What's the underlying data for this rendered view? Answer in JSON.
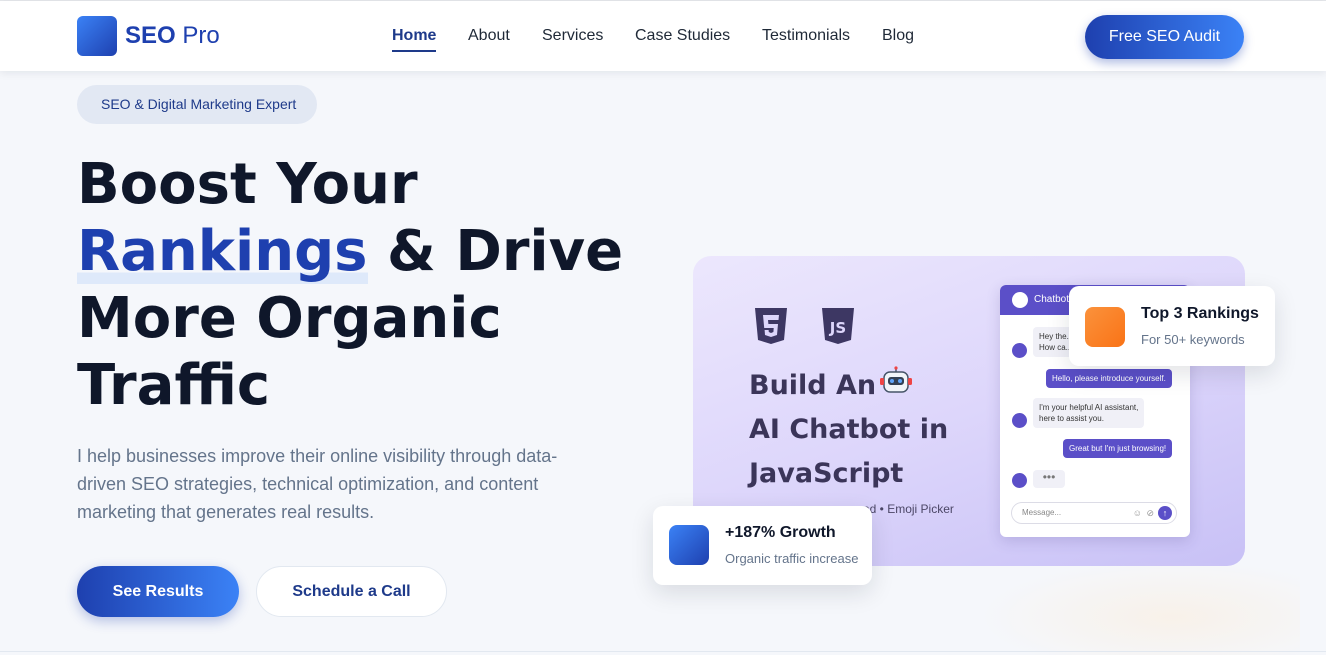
{
  "brand": {
    "name_bold": "SEO",
    "name_light": "Pro"
  },
  "nav": {
    "items": [
      {
        "label": "Home",
        "active": true
      },
      {
        "label": "About"
      },
      {
        "label": "Services"
      },
      {
        "label": "Case Studies"
      },
      {
        "label": "Testimonials"
      },
      {
        "label": "Blog"
      }
    ],
    "cta_label": "Free SEO Audit"
  },
  "hero": {
    "badge": "SEO & Digital Marketing Expert",
    "headline": {
      "line1": "Boost Your",
      "accent": "Rankings",
      "line2_rest": "& Drive",
      "line3": "More Organic",
      "line4": "Traffic"
    },
    "description": "I help businesses improve their online visibility through data-driven SEO strategies, technical optimization, and content marketing that generates real results.",
    "primary_button": "See Results",
    "secondary_button": "Schedule a Call"
  },
  "hero_image": {
    "title_line1": "Build An",
    "title_line2": "AI Chatbot in",
    "title_line3": "JavaScript",
    "subtitle": "ad • Emoji Picker",
    "chat": {
      "header": "Chatbot",
      "messages": [
        {
          "from": "bot",
          "text": "Hey the..."
        },
        {
          "from": "bot",
          "text": "How ca..."
        },
        {
          "from": "user",
          "text": "Hello, please introduce yourself."
        },
        {
          "from": "bot",
          "text": "I'm your helpful AI assistant,"
        },
        {
          "from": "bot",
          "text": "here to assist you."
        },
        {
          "from": "user",
          "text": "Great but I'm just browsing!"
        }
      ],
      "typing": "•••",
      "input_placeholder": "Message...",
      "send_icon": "↑"
    }
  },
  "stats": {
    "rankings": {
      "title": "Top 3 Rankings",
      "subtitle": "For 50+ keywords",
      "color": "#f97316"
    },
    "growth": {
      "title": "+187% Growth",
      "subtitle": "Organic traffic increase",
      "color": "#2563eb"
    }
  },
  "colors": {
    "primary": "#1e40af",
    "primary_light": "#3b82f6",
    "text_dark": "#0f172a",
    "text_muted": "#64748b"
  }
}
